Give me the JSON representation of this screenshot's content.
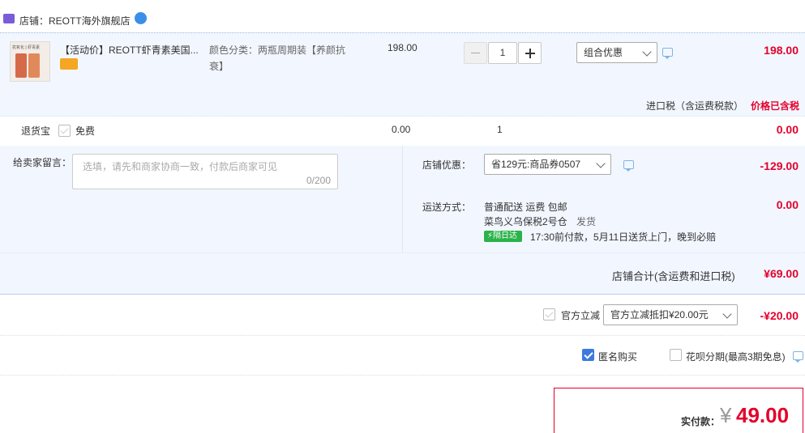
{
  "shop": {
    "label": "店铺：REOTT海外旗舰店"
  },
  "item": {
    "thumb_text": "抗氧化 | 虾青素",
    "title": "【活动价】REOTT虾青素美国...",
    "sku_line1": "颜色分类：两瓶周期装【养颜抗",
    "sku_line2": "衰】",
    "unit_price": "198.00",
    "qty": "1",
    "promo_select": "组合优惠",
    "subtotal": "198.00"
  },
  "tax": {
    "label": "进口税（含运费税款）",
    "value": "价格已含税"
  },
  "return_insurance": {
    "label": "退货宝",
    "option": "免费",
    "price": "0.00",
    "qty": "1",
    "total": "0.00"
  },
  "message": {
    "label": "给卖家留言：",
    "placeholder": "选填，请先和商家协商一致，付款后商家可见",
    "counter": "0/200"
  },
  "shop_discount": {
    "label": "店铺优惠：",
    "selected": "省129元:商品券0507",
    "value": "-129.00"
  },
  "shipping": {
    "label": "运送方式：",
    "method": "普通配送 运费 包邮",
    "warehouse": "菜鸟义乌保税2号仓",
    "dispatch": "发货",
    "badge": "隔日达",
    "eta": "17:30前付款，5月11日送货上门，晚到必赔",
    "value": "0.00"
  },
  "shop_total": {
    "label": "店铺合计(含运费和进口税)",
    "value": "¥69.00"
  },
  "official_discount": {
    "label": "官方立减",
    "selected": "官方立减抵扣¥20.00元",
    "value": "-¥20.00"
  },
  "options": {
    "anonymous": "匿名购买",
    "installment": "花呗分期(最高3期免息)"
  },
  "pay": {
    "label": "实付款：",
    "currency": "¥",
    "amount": "49.00"
  },
  "colors": {
    "accent_red": "#e4002b",
    "blue": "#3d7ae0",
    "row_bg": "#f2f7ff"
  }
}
